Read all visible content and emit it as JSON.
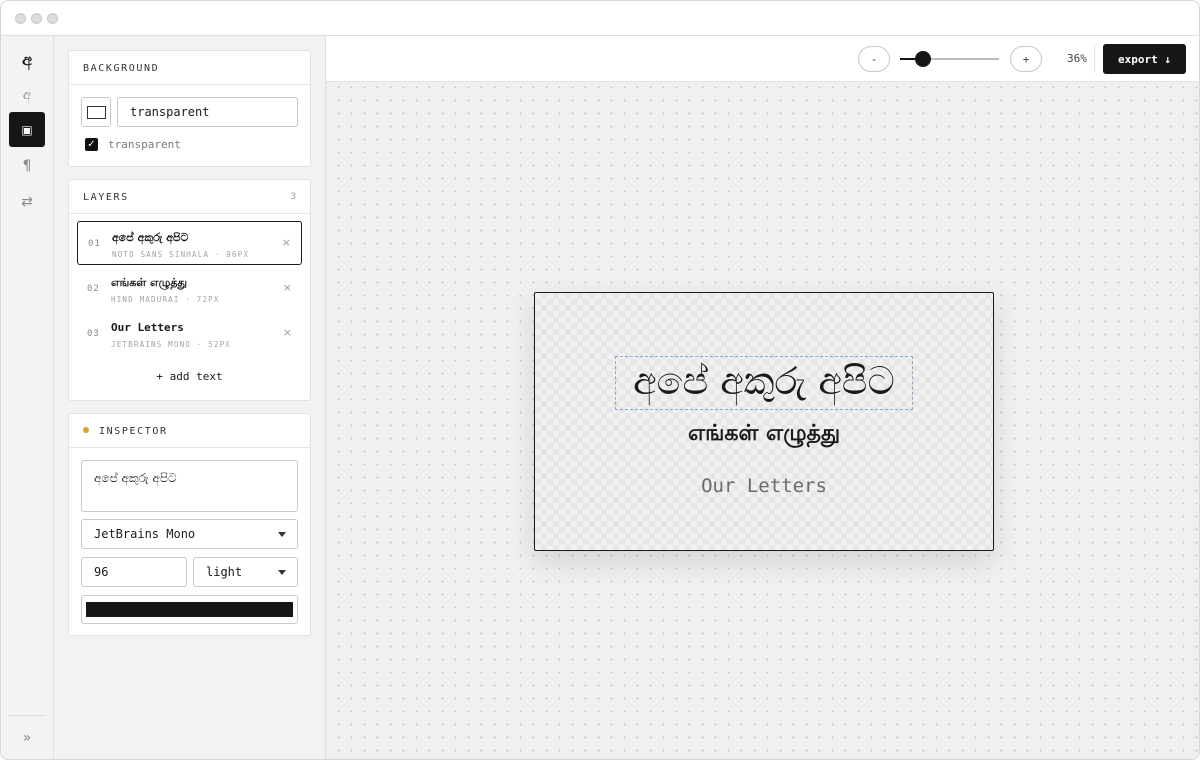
{
  "zoom": {
    "minus_label": "-",
    "plus_label": "+",
    "value_label": "36%",
    "level_fraction": 0.18
  },
  "export_label": "export ↓",
  "rail": {
    "logo_glyph": "අ",
    "items": [
      {
        "name": "text-tool",
        "glyph": "අ"
      },
      {
        "name": "frame-tool",
        "glyph": "▣"
      },
      {
        "name": "paragraph-tool",
        "glyph": "¶"
      },
      {
        "name": "swap-tool",
        "glyph": "⇄"
      }
    ],
    "expand_glyph": "»"
  },
  "background": {
    "title": "BACKGROUND",
    "value": "transparent",
    "checkbox_label": "transparent",
    "checked": true
  },
  "layers": {
    "title": "LAYERS",
    "count": "3",
    "items": [
      {
        "num": "01",
        "name": "අපේ අකුරු අපිට",
        "meta": "NOTO SANS SINHALA · 96PX",
        "close": "×"
      },
      {
        "num": "02",
        "name": "எங்கள் எழுத்து",
        "meta": "HIND MADURAI · 72PX",
        "close": "×"
      },
      {
        "num": "03",
        "name": "Our Letters",
        "meta": "JETBRAINS MONO · 52PX",
        "close": "×"
      }
    ],
    "add_label": "+ add text"
  },
  "inspector": {
    "title": "INSPECTOR",
    "text_value": "අපේ අකුරු අපිට",
    "font_value": "JetBrains Mono",
    "size_value": "96",
    "weight_value": "light",
    "color": "#161616"
  },
  "canvas": {
    "line1": "අපේ අකුරු අපිට",
    "line2": "எங்கள் எழுத்து",
    "line3": "Our Letters"
  },
  "colors": {
    "accent": "#161616",
    "inspector_dot": "#d9a12c",
    "selection": "#8aa8cc"
  }
}
